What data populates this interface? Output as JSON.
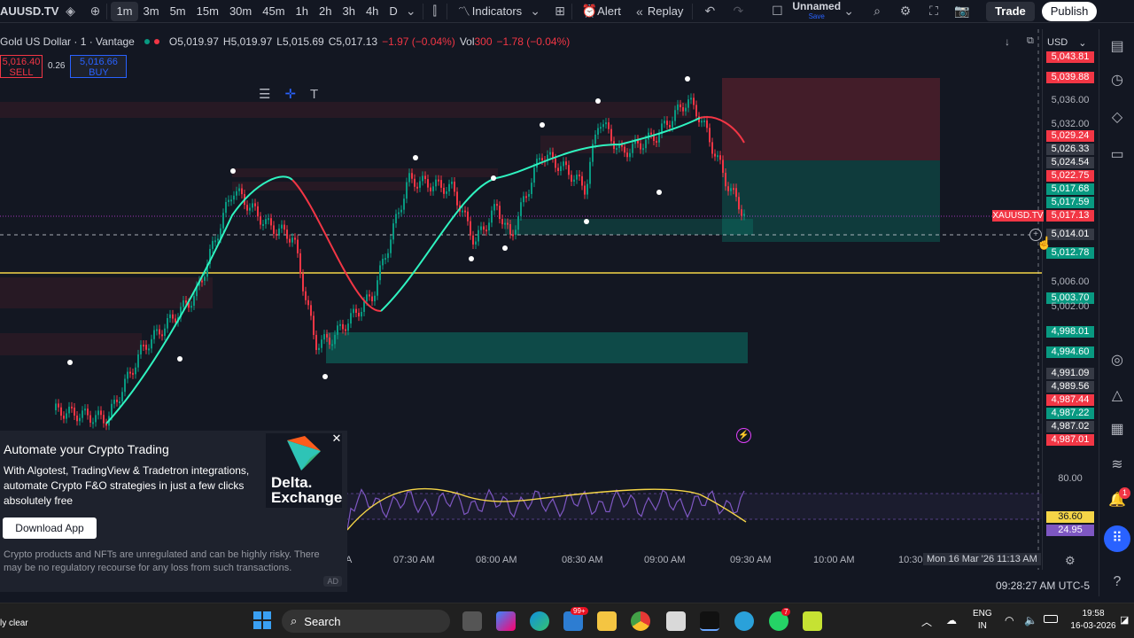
{
  "toolbar": {
    "symbol": "AUUSD.TV",
    "timeframes": [
      "1m",
      "3m",
      "5m",
      "15m",
      "30m",
      "45m",
      "1h",
      "2h",
      "3h",
      "4h",
      "D"
    ],
    "active_timeframe": "1m",
    "indicators": "Indicators",
    "alert": "Alert",
    "replay": "Replay",
    "layout_name": "Unnamed",
    "layout_status": "Save",
    "trade": "Trade",
    "publish": "Publish"
  },
  "legend": {
    "title": "Gold US Dollar · 1 · Vantage",
    "open": "O5,019.97",
    "high": "H5,019.97",
    "low": "L5,015.69",
    "close": "C5,017.13",
    "change": "−1.97 (−0.04%)",
    "vol_label": "Vol",
    "vol_value": "300",
    "vol_change": "−1.78 (−0.04%)"
  },
  "order_panel": {
    "sell_price": "5,016.40",
    "sell_label": "SELL",
    "spread": "0.26",
    "buy_price": "5,016.66",
    "buy_label": "BUY"
  },
  "price_scale": {
    "currency": "USD",
    "ticks": [
      "5,036.00",
      "5,032.00",
      "5,006.00",
      "5,002.00",
      "80.00"
    ],
    "labels": [
      {
        "text": "5,043.81",
        "color": "#f23645"
      },
      {
        "text": "5,039.88",
        "color": "#f23645"
      },
      {
        "text": "5,029.24",
        "color": "#f23645"
      },
      {
        "text": "5,026.33",
        "color": "#363a45"
      },
      {
        "text": "5,024.54",
        "color": "#363a45"
      },
      {
        "text": "5,022.75",
        "color": "#f23645"
      },
      {
        "text": "5,017.68",
        "color": "#089981"
      },
      {
        "text": "5,017.59",
        "color": "#089981"
      },
      {
        "text": "5,017.13",
        "color": "#f23645"
      },
      {
        "text": "5,014.01",
        "color": "#363a45"
      },
      {
        "text": "5,012.78",
        "color": "#089981"
      },
      {
        "text": "5,003.70",
        "color": "#089981"
      },
      {
        "text": "4,998.01",
        "color": "#089981"
      },
      {
        "text": "4,994.60",
        "color": "#089981"
      },
      {
        "text": "4,991.09",
        "color": "#363a45"
      },
      {
        "text": "4,989.56",
        "color": "#363a45"
      },
      {
        "text": "4,987.44",
        "color": "#f23645"
      },
      {
        "text": "4,987.22",
        "color": "#089981"
      },
      {
        "text": "4,987.02",
        "color": "#363a45"
      },
      {
        "text": "4,987.01",
        "color": "#f23645"
      },
      {
        "text": "36.60",
        "color": "#f5d547"
      },
      {
        "text": "24.95",
        "color": "#7e57c2"
      }
    ],
    "symbol_tag": "XAUUSD.TV"
  },
  "time_axis": {
    "labels": [
      "07:30 AM",
      "08:00 AM",
      "08:30 AM",
      "09:00 AM",
      "09:30 AM",
      "10:00 AM",
      "10:30"
    ],
    "first_partial": "A",
    "cursor": "Mon 16 Mar '26   11:13 AM"
  },
  "status": {
    "clock": "09:28:27 AM UTC-5"
  },
  "ad": {
    "title": "Automate your Crypto Trading",
    "body": "With Algotest, TradingView & Tradetron integrations, automate Crypto F&O strategies in just a few clicks absolutely free",
    "button": "Download App",
    "disclaimer": "Crypto products and NFTs are unregulated and can be highly risky. There may be no regulatory recourse for any loss from such transactions.",
    "tag": "AD",
    "brand": "Delta. Exchange"
  },
  "taskbar": {
    "weather": "ly clear",
    "search": "Search",
    "badge_mail": "99+",
    "badge_whatsapp": "7",
    "lang_top": "ENG",
    "lang_bottom": "IN",
    "time": "19:58",
    "date": "16-03-2026"
  },
  "notif_count": "1"
}
